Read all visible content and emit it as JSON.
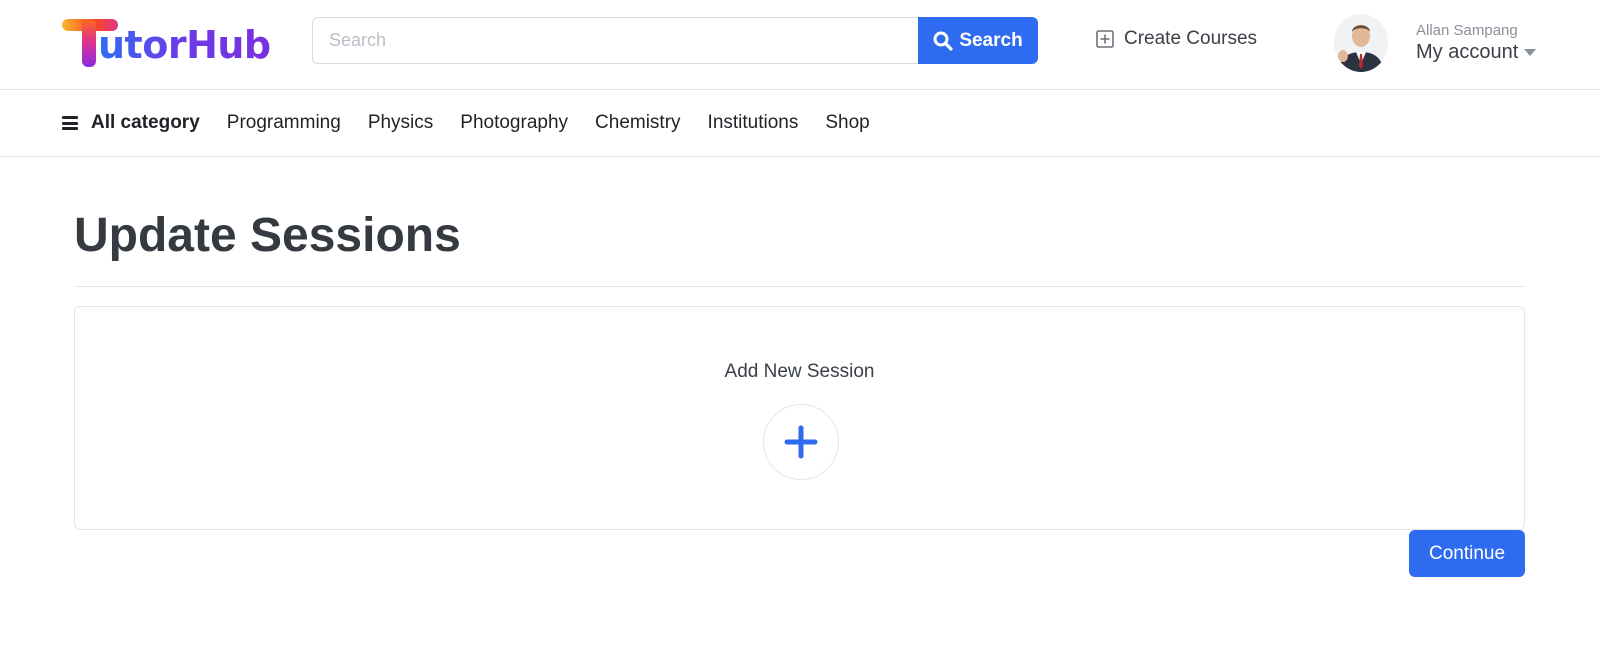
{
  "brand": {
    "name": "TutorHub",
    "logo_letter": "T",
    "logo_rest": "utorHub"
  },
  "search": {
    "placeholder": "Search",
    "value": "",
    "button_label": "Search",
    "icon": "search-icon"
  },
  "header": {
    "create_courses_label": "Create Courses",
    "create_courses_icon": "plus-square-icon",
    "account": {
      "name": "Allan Sampang",
      "link_label": "My account"
    }
  },
  "category_nav": {
    "all_label": "All category",
    "items": [
      "Programming",
      "Physics",
      "Photography",
      "Chemistry",
      "Institutions",
      "Shop"
    ]
  },
  "main": {
    "title": "Update Sessions",
    "add_session_label": "Add New Session",
    "continue_label": "Continue"
  },
  "colors": {
    "primary": "#2e6bf0",
    "title": "#343a40",
    "border": "#e4e6ea"
  }
}
